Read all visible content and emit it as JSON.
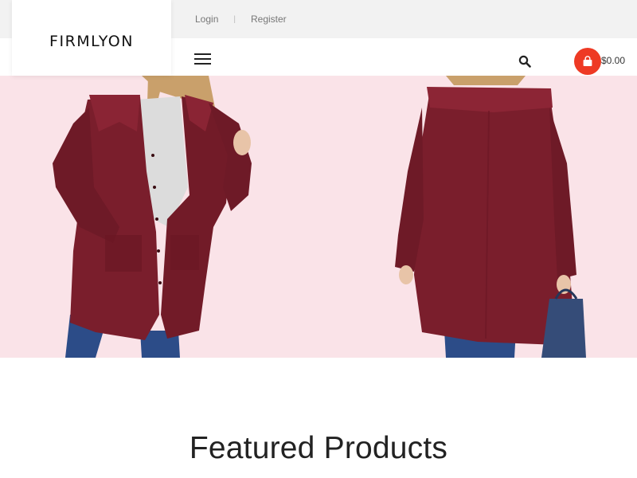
{
  "header": {
    "logo": "FIRMLYON",
    "login_label": "Login",
    "separator": "|",
    "register_label": "Register",
    "menu_icon": "hamburger-menu-icon",
    "search_icon": "search-icon",
    "cart_icon": "shopping-bag-icon",
    "cart_total": "$0.00"
  },
  "colors": {
    "accent": "#ee3a24",
    "topbar_bg": "#f2f2f2",
    "hero_bg": "#fae3e8",
    "coat": "#7a1e2c"
  },
  "hero": {
    "image_description": "Two product photos of a burgundy fleece button-up coat, front and back views"
  },
  "featured": {
    "title": "Featured Products"
  }
}
